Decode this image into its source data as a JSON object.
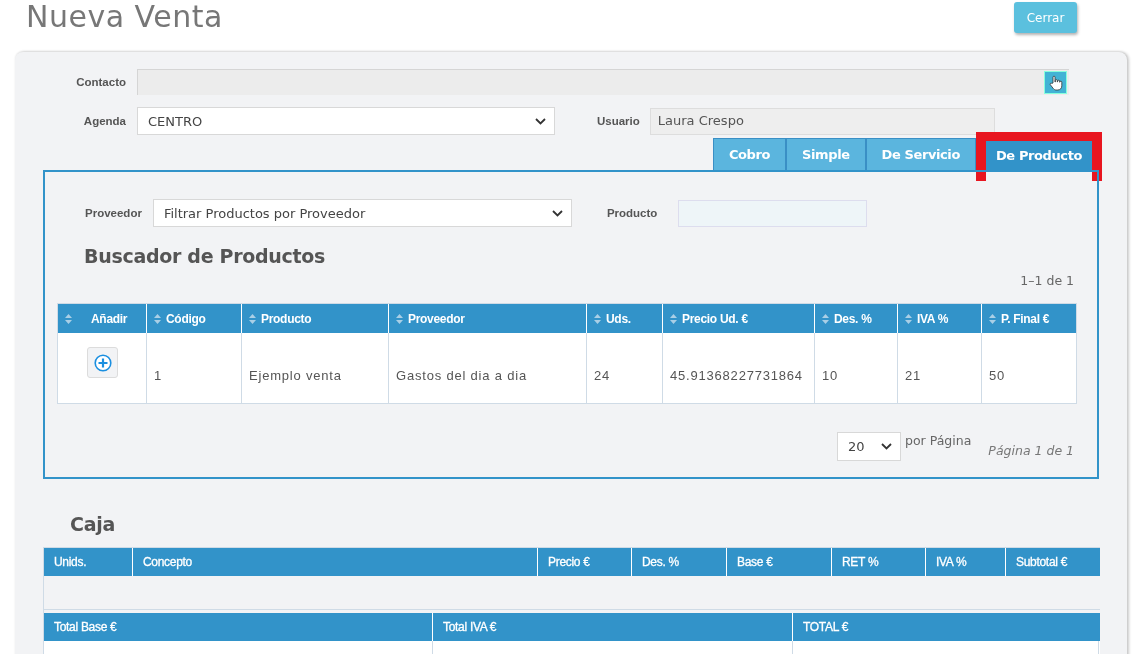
{
  "title": "Nueva Venta",
  "close_button": "Cerrar",
  "contact": {
    "label": "Contacto"
  },
  "agenda": {
    "label": "Agenda",
    "value": "CENTRO"
  },
  "user": {
    "label": "Usuario",
    "value": "Laura Crespo"
  },
  "tabs": [
    {
      "label": "Cobro",
      "selected": false
    },
    {
      "label": "Simple",
      "selected": false
    },
    {
      "label": "De Servicio",
      "selected": false
    },
    {
      "label": "De Producto",
      "selected": true
    }
  ],
  "filters": {
    "supplier_label": "Proveedor",
    "supplier_value": "Filtrar Productos por Proveedor",
    "product_label": "Producto"
  },
  "product_search": {
    "heading": "Buscador de Productos",
    "range": "1–1 de 1",
    "columns": [
      "Añadir",
      "Código",
      "Producto",
      "Proveedor",
      "Uds.",
      "Precio Ud. €",
      "Des. %",
      "IVA %",
      "P. Final €"
    ],
    "rows": [
      {
        "cells": [
          "",
          "1",
          "Ejemplo venta",
          "Gastos del dia a dia",
          "24",
          "45.91368227731864",
          "10",
          "21",
          "50"
        ]
      }
    ],
    "page_size": "20",
    "per_page_label": "por Página",
    "page_info": "Página 1 de 1"
  },
  "cash": {
    "heading": "Caja",
    "columns": [
      "Unids.",
      "Concepto",
      "Precio €",
      "Des. %",
      "Base €",
      "RET %",
      "IVA %",
      "Subtotal €"
    ],
    "totals_columns": [
      "Total Base €",
      "Total IVA €",
      "TOTAL €"
    ]
  }
}
